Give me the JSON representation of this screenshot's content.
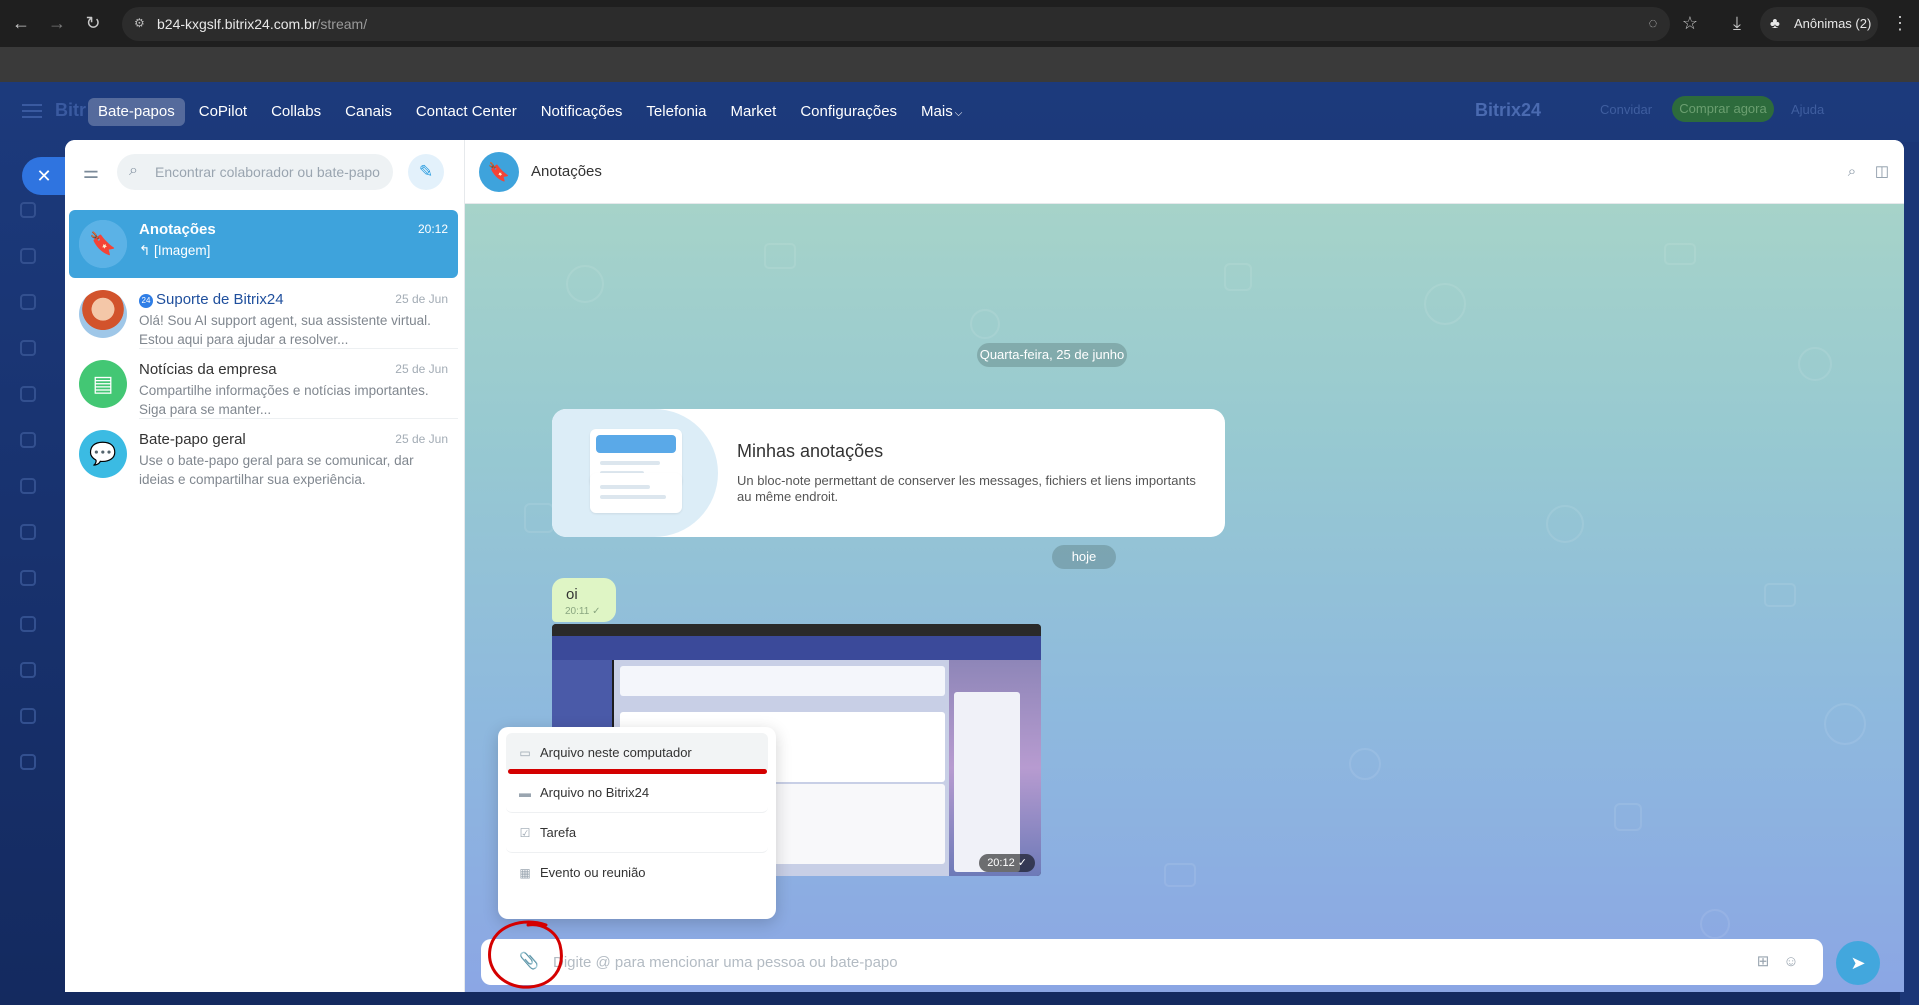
{
  "browser": {
    "url_host": "b24-kxgslf.bitrix24.com.br",
    "url_path": "/stream/",
    "incognito_label": "Anônimas (2)"
  },
  "portal": {
    "brand_left": "Bitr",
    "brand_right": "Bitrix24",
    "faded_links": [
      "Convidar",
      "Comprar agora",
      "Ajuda"
    ]
  },
  "topmenu": {
    "items": [
      "Bate-papos",
      "CoPilot",
      "Collabs",
      "Canais",
      "Contact Center",
      "Notificações",
      "Telefonia",
      "Market",
      "Configurações"
    ],
    "more_label": "Mais",
    "active_index": 0
  },
  "chatlist": {
    "search_placeholder": "Encontrar colaborador ou bate-papo",
    "items": [
      {
        "title": "Anotações",
        "date": "20:12",
        "preview": "↰ [Imagem]",
        "icon": "bookmark-icon",
        "active": true
      },
      {
        "title": "Suporte de Bitrix24",
        "date": "25 de Jun",
        "preview": "Olá! Sou AI support agent, sua assistente virtual. Estou aqui para ajudar a resolver...",
        "badge": "24"
      },
      {
        "title": "Notícias da empresa",
        "date": "25 de Jun",
        "preview": "Compartilhe informações e notícias importantes. Siga para se manter..."
      },
      {
        "title": "Bate-papo geral",
        "date": "25 de Jun",
        "preview": "Use o bate-papo geral para se comunicar, dar ideias e compartilhar sua experiência."
      }
    ]
  },
  "dialog": {
    "title": "Anotações",
    "date_divider": "Quarta-feira, 25 de junho",
    "today_divider": "hoje",
    "intro": {
      "title": "Minhas anotações",
      "text": "Un bloc-note permettant de conserver les messages, fichiers et liens importants au même endroit."
    },
    "message": {
      "text": "oi",
      "time": "20:11"
    },
    "image_time": "20:12"
  },
  "attach_menu": {
    "items": [
      "Arquivo neste computador",
      "Arquivo no Bitrix24",
      "Tarefa",
      "Evento ou reunião"
    ]
  },
  "input": {
    "placeholder": "Digite @ para mencionar uma pessoa ou bate-papo"
  },
  "colors": {
    "accent": "#3ea3dc",
    "portal_bg": "#1c3a7c",
    "annotation_red": "#d40000"
  }
}
